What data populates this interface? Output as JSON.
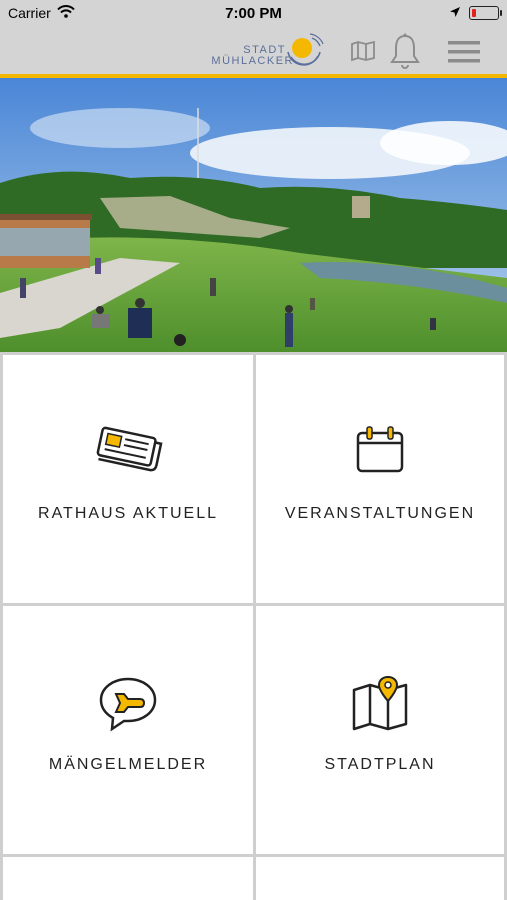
{
  "status_bar": {
    "carrier": "Carrier",
    "time": "7:00 PM",
    "battery_level": 0.15
  },
  "header": {
    "logo_line1": "STADT",
    "logo_line2": "MÜHLACKER",
    "icons": [
      "map-icon",
      "bell-icon",
      "menu-icon"
    ],
    "accent_color": "#f5b800"
  },
  "tiles": [
    {
      "label": "RATHAUS AKTUELL",
      "icon": "newspaper-icon"
    },
    {
      "label": "VERANSTALTUNGEN",
      "icon": "calendar-icon"
    },
    {
      "label": "MÄNGELMELDER",
      "icon": "wrench-chat-icon"
    },
    {
      "label": "STADTPLAN",
      "icon": "map-pin-icon"
    }
  ]
}
